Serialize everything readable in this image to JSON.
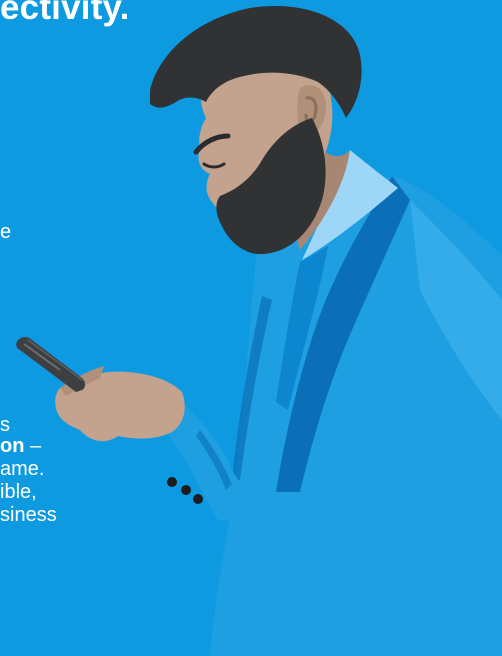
{
  "headline": "ectivity.",
  "body_fragments": {
    "f1": "e",
    "f2": "s",
    "f3_bold": "on",
    "f3_rest": " –",
    "f4": "ame.",
    "f5": "ible,",
    "f6": "siness"
  },
  "colors": {
    "background": "#0e9ae0",
    "suit_main": "#1e9fe2",
    "suit_dark": "#0a6fb7",
    "suit_light": "#47b6ee",
    "shirt": "#9ed6f7",
    "skin": "#c3a38d",
    "skin_shadow": "#a78773",
    "hair": "#303234",
    "phone": "#3d3f42"
  }
}
